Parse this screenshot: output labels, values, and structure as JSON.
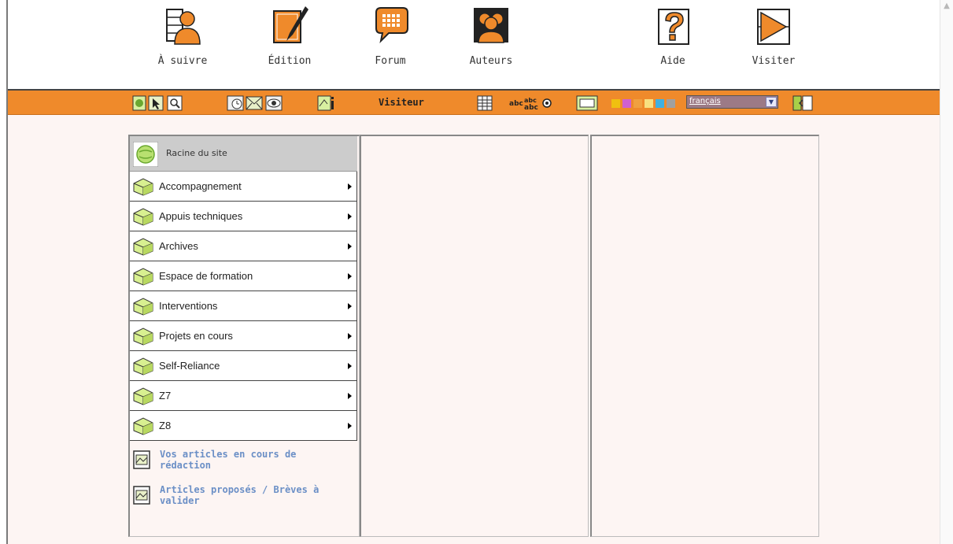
{
  "top_nav": {
    "items": [
      {
        "label": "À suivre",
        "icon": "follow-icon"
      },
      {
        "label": "Édition",
        "icon": "edit-icon"
      },
      {
        "label": "Forum",
        "icon": "forum-icon"
      },
      {
        "label": "Auteurs",
        "icon": "authors-icon"
      },
      {
        "label": "Aide",
        "icon": "help-icon"
      },
      {
        "label": "Visiter",
        "icon": "visit-icon"
      }
    ]
  },
  "toolbar": {
    "user_label": "Visiteur",
    "language": "français",
    "colors": {
      "bar": "#ef8a2b",
      "swatches": [
        "#f0c010",
        "#d060d0",
        "#f0a040",
        "#f8e080",
        "#40b0e0",
        "#a0a0a0"
      ]
    }
  },
  "root": {
    "label": "Racine du site"
  },
  "rubriques": [
    {
      "label": "Accompagnement"
    },
    {
      "label": "Appuis techniques"
    },
    {
      "label": "Archives"
    },
    {
      "label": "Espace de formation"
    },
    {
      "label": "Interventions"
    },
    {
      "label": "Projets en cours"
    },
    {
      "label": "Self-Reliance"
    },
    {
      "label": "Z7"
    },
    {
      "label": "Z8"
    }
  ],
  "links": [
    {
      "label": "Vos articles en cours de rédaction"
    },
    {
      "label": "Articles proposés / Brèves à valider"
    }
  ]
}
